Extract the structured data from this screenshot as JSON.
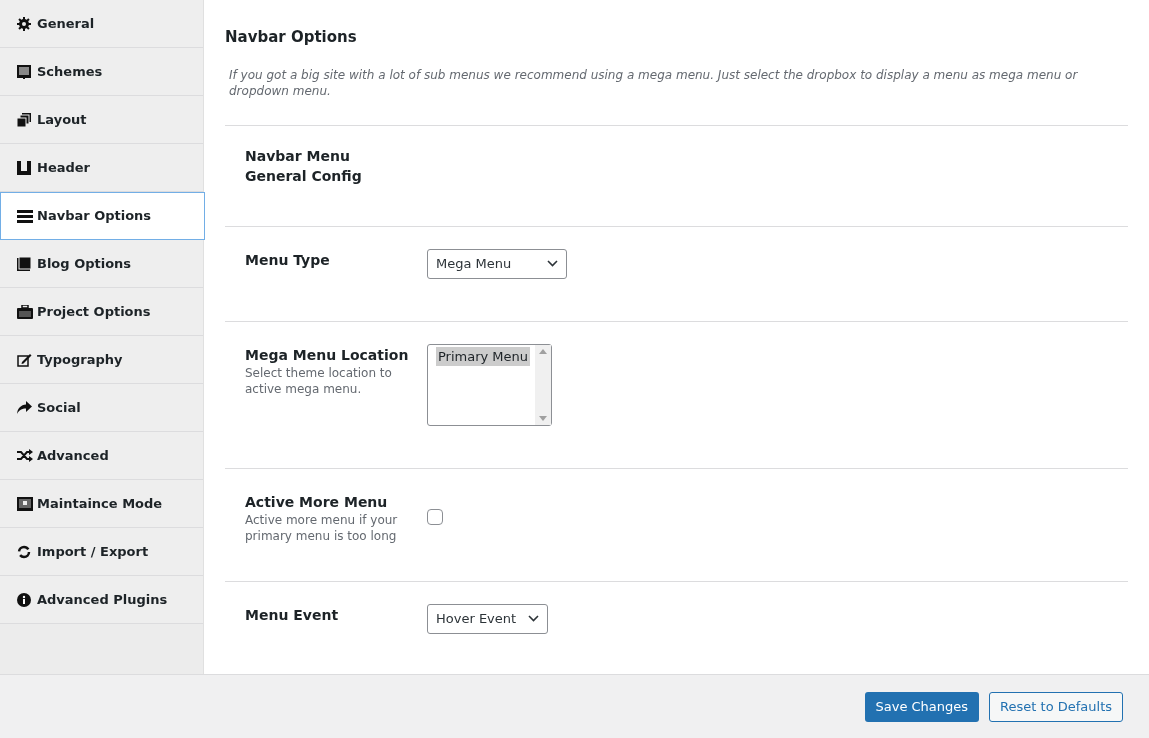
{
  "sidebar": {
    "items": [
      {
        "label": "General",
        "selected": false
      },
      {
        "label": "Schemes",
        "selected": false
      },
      {
        "label": "Layout",
        "selected": false
      },
      {
        "label": "Header",
        "selected": false
      },
      {
        "label": "Navbar Options",
        "selected": true
      },
      {
        "label": "Blog Options",
        "selected": false
      },
      {
        "label": "Project Options",
        "selected": false
      },
      {
        "label": "Typography",
        "selected": false
      },
      {
        "label": "Social",
        "selected": false
      },
      {
        "label": "Advanced",
        "selected": false
      },
      {
        "label": "Maintaince Mode",
        "selected": false
      },
      {
        "label": "Import / Export",
        "selected": false
      },
      {
        "label": "Advanced Plugins",
        "selected": false
      }
    ]
  },
  "section": {
    "title": "Navbar Options",
    "description": "If you got a big site with a lot of sub menus we recommend using a mega menu. Just select the dropbox to display a menu as mega menu or dropdown menu."
  },
  "rows": [
    {
      "kind": "heading",
      "label": "Navbar Menu General Config"
    },
    {
      "kind": "select",
      "label": "Menu Type",
      "value": "Mega Menu"
    },
    {
      "kind": "listbox",
      "label": "Mega Menu Location",
      "description": "Select theme location to active mega menu.",
      "options": [
        {
          "label": "Primary Menu",
          "selected": true
        }
      ]
    },
    {
      "kind": "checkbox",
      "label": "Active More Menu",
      "description": "Active more menu if your primary menu is too long",
      "checked": false
    },
    {
      "kind": "select",
      "label": "Menu Event",
      "value": "Hover Event"
    }
  ],
  "footer": {
    "buttons": [
      {
        "label": "Save Changes",
        "kind": "primary"
      },
      {
        "label": "Reset to Defaults",
        "kind": "secondary"
      }
    ]
  }
}
